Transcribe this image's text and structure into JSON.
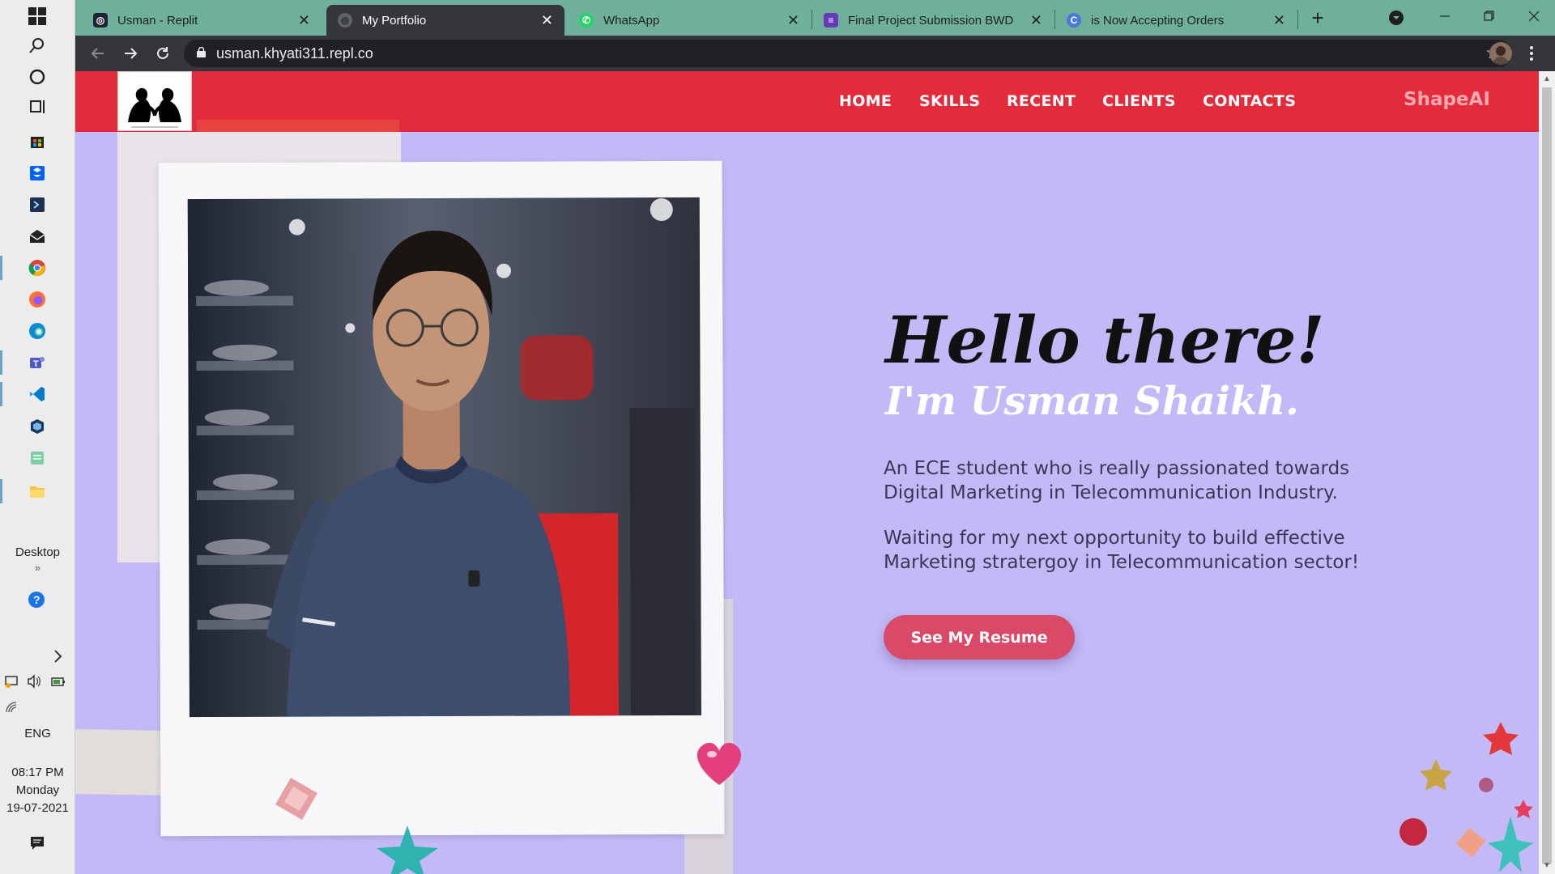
{
  "taskbar": {
    "desktop_label": "Desktop",
    "desktop_chevron": "»",
    "language": "ENG",
    "time": "08:17 PM",
    "day": "Monday",
    "date": "19-07-2021"
  },
  "tabs": [
    {
      "title": "Usman - Replit",
      "icon": "replit-icon",
      "active": false
    },
    {
      "title": "My Portfolio",
      "icon": "globe-icon",
      "active": true
    },
    {
      "title": "WhatsApp",
      "icon": "whatsapp-icon",
      "active": false
    },
    {
      "title": "Final Project Submission BWD",
      "icon": "form-icon",
      "active": false
    },
    {
      "title": "is Now Accepting Orders",
      "icon": "c-icon",
      "active": false
    }
  ],
  "tab_close": "✕",
  "new_tab": "+",
  "address_bar": {
    "url": "usman.khyati311.repl.co"
  },
  "site": {
    "nav": [
      "HOME",
      "SKILLS",
      "RECENT",
      "CLIENTS",
      "CONTACTS"
    ],
    "brand": "ShapeAI",
    "hero": {
      "greeting": "Hello there!",
      "name": "I'm Usman Shaikh.",
      "paragraph1": "An ECE student who is really passionated towards Digital Marketing in Telecommunication Industry.",
      "paragraph2": "Waiting for my next opportunity to build effective Marketing stratergoy in Telecommunication sector!",
      "button": "See My Resume"
    }
  },
  "colors": {
    "header_red": "#e32b3b",
    "page_bg": "#c3b9f6",
    "button": "#d94a68",
    "tabstrip": "#6fb09c"
  }
}
